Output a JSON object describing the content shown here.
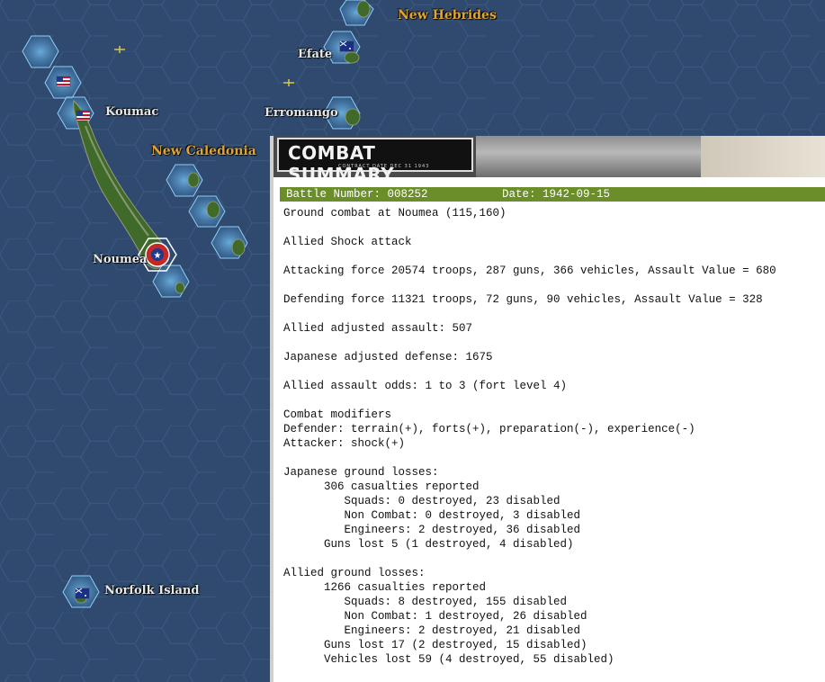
{
  "map": {
    "labels": {
      "new_hebrides": "New Hebrides",
      "efate": "Efate",
      "erromango": "Erromango",
      "koumac": "Koumac",
      "new_caledonia": "New Caledonia",
      "noumea": "Noumea",
      "norfolk_island": "Norfolk Island"
    },
    "colors": {
      "ocean": "#2f4a6e",
      "hex_line": "#3e5a82",
      "coast_glow": "#5f9fd0",
      "island": "#3f6a2a",
      "region_label": "#e0a530"
    }
  },
  "panel": {
    "banner_title": "COMBAT SUMMARY",
    "banner_subtitle": "CONTRACT DATE DEC 31 1943",
    "battle_number": "Battle Number: 008252",
    "date": "Date: 1942-09-15",
    "header_color": "#6b8e2a",
    "lines": [
      "Ground combat at Noumea (115,160)",
      "",
      "Allied Shock attack",
      "",
      "Attacking force 20574 troops, 287 guns, 366 vehicles, Assault Value = 680",
      "",
      "Defending force 11321 troops, 72 guns, 90 vehicles, Assault Value = 328",
      "",
      "Allied adjusted assault: 507",
      "",
      "Japanese adjusted defense: 1675",
      "",
      "Allied assault odds: 1 to 3 (fort level 4)",
      "",
      "Combat modifiers",
      "Defender: terrain(+), forts(+), preparation(-), experience(-)",
      "Attacker: shock(+)",
      "",
      "Japanese ground losses:",
      "      306 casualties reported",
      "         Squads: 0 destroyed, 23 disabled",
      "         Non Combat: 0 destroyed, 3 disabled",
      "         Engineers: 2 destroyed, 36 disabled",
      "      Guns lost 5 (1 destroyed, 4 disabled)",
      "",
      "Allied ground losses:",
      "      1266 casualties reported",
      "         Squads: 8 destroyed, 155 disabled",
      "         Non Combat: 1 destroyed, 26 disabled",
      "         Engineers: 2 destroyed, 21 disabled",
      "      Guns lost 17 (2 destroyed, 15 disabled)",
      "      Vehicles lost 59 (4 destroyed, 55 disabled)"
    ]
  }
}
